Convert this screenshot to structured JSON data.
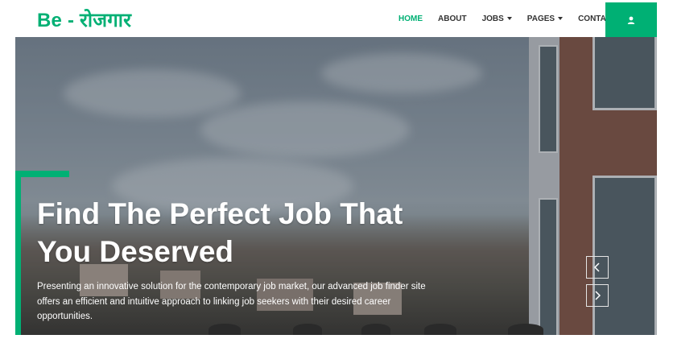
{
  "navbar": {
    "brand": "Be - रोजगार",
    "items": [
      {
        "label": "HOME",
        "active": true
      },
      {
        "label": "ABOUT"
      },
      {
        "label": "JOBS"
      },
      {
        "label": "PAGES"
      },
      {
        "label": "CONTACT"
      }
    ],
    "user_icon": "user-icon"
  },
  "hero": {
    "headline_line1": "Find The Perfect Job That",
    "headline_line2": "You Deserved",
    "description": "Presenting an innovative solution for the contemporary job market, our advanced job finder site offers an efficient and intuitive approach to linking job seekers with their desired career opportunities.",
    "prev_icon": "chevron-left-icon",
    "next_icon": "chevron-right-icon"
  },
  "colors": {
    "accent": "#00b074",
    "nav_text": "#333333",
    "hero_text": "#ffffff"
  }
}
